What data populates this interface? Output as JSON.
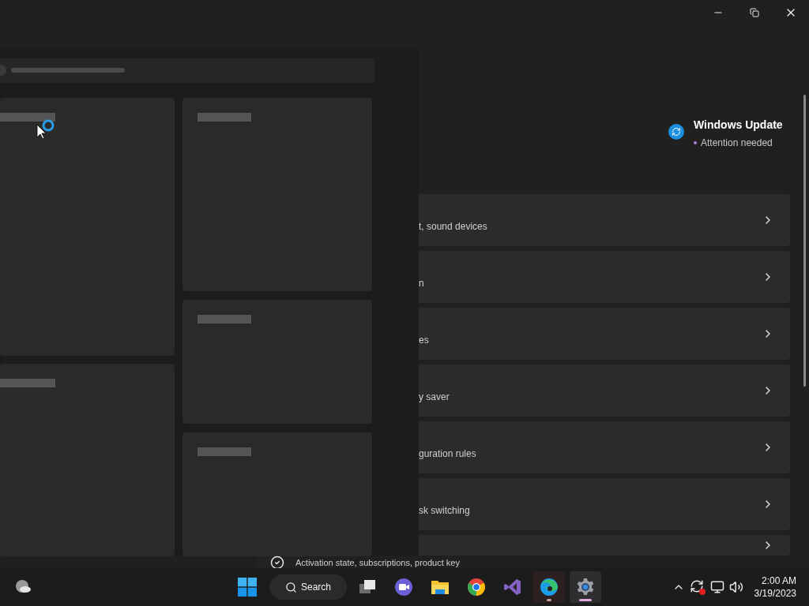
{
  "update": {
    "title": "Windows Update",
    "status": "Attention needed"
  },
  "settings_rows": [
    {
      "description": "t, sound devices"
    },
    {
      "description": "n"
    },
    {
      "description": "es"
    },
    {
      "description": "y saver"
    },
    {
      "description": "guration rules"
    },
    {
      "description": "sk switching"
    },
    {}
  ],
  "activation_row": {
    "description": "Activation state, subscriptions, product key"
  },
  "taskbar": {
    "search_label": "Search",
    "apps": [
      {
        "kind": "taskview",
        "running": false,
        "selected": false
      },
      {
        "kind": "chat",
        "running": false,
        "selected": false
      },
      {
        "kind": "explorer",
        "running": false,
        "selected": false
      },
      {
        "kind": "chrome",
        "running": false,
        "selected": false
      },
      {
        "kind": "vs",
        "running": false,
        "selected": false
      },
      {
        "kind": "edge",
        "running": true,
        "selected": false
      },
      {
        "kind": "settings",
        "running": true,
        "selected": true
      }
    ],
    "time": "2:00 AM",
    "date": "3/19/2023"
  }
}
